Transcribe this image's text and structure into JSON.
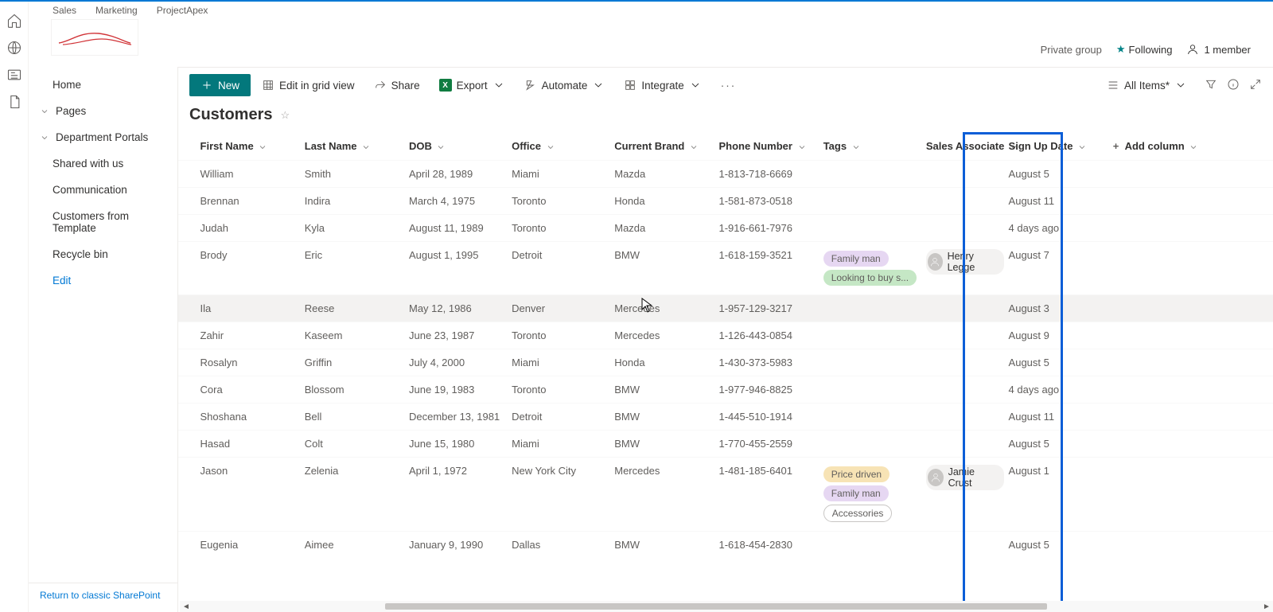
{
  "header": {
    "tabs": [
      "Sales",
      "Marketing",
      "ProjectApex"
    ],
    "private_group": "Private group",
    "following": "Following",
    "members": "1 member"
  },
  "nav": {
    "items": [
      {
        "label": "Home",
        "chev": false
      },
      {
        "label": "Pages",
        "chev": true
      },
      {
        "label": "Department Portals",
        "chev": true
      },
      {
        "label": "Shared with us",
        "chev": false
      },
      {
        "label": "Communication",
        "chev": false
      },
      {
        "label": "Customers from Template",
        "chev": false
      },
      {
        "label": "Recycle bin",
        "chev": false
      }
    ],
    "edit": "Edit",
    "footer": "Return to classic SharePoint"
  },
  "cmdbar": {
    "new_label": "New",
    "edit_grid": "Edit in grid view",
    "share": "Share",
    "export": "Export",
    "automate": "Automate",
    "integrate": "Integrate",
    "view": "All Items*"
  },
  "list": {
    "title": "Customers",
    "columns": [
      "First Name",
      "Last Name",
      "DOB",
      "Office",
      "Current Brand",
      "Phone Number",
      "Tags",
      "Sales Associate",
      "Sign Up Date"
    ],
    "add_column": "Add column",
    "rows": [
      {
        "fn": "William",
        "ln": "Smith",
        "dob": "April 28, 1989",
        "off": "Miami",
        "brand": "Mazda",
        "phone": "1-813-718-6669",
        "tags": [],
        "assoc": "",
        "sign": "August 5"
      },
      {
        "fn": "Brennan",
        "ln": "Indira",
        "dob": "March 4, 1975",
        "off": "Toronto",
        "brand": "Honda",
        "phone": "1-581-873-0518",
        "tags": [],
        "assoc": "",
        "sign": "August 11"
      },
      {
        "fn": "Judah",
        "ln": "Kyla",
        "dob": "August 11, 1989",
        "off": "Toronto",
        "brand": "Mazda",
        "phone": "1-916-661-7976",
        "tags": [],
        "assoc": "",
        "sign": "4 days ago"
      },
      {
        "fn": "Brody",
        "ln": "Eric",
        "dob": "August 1, 1995",
        "off": "Detroit",
        "brand": "BMW",
        "phone": "1-618-159-3521",
        "tags": [
          {
            "t": "Family man",
            "c": "#e6d7f2"
          },
          {
            "t": "Looking to buy s...",
            "c": "#c5e7c5"
          }
        ],
        "assoc": "Henry Legge",
        "sign": "August 7"
      },
      {
        "fn": "Ila",
        "ln": "Reese",
        "dob": "May 12, 1986",
        "off": "Denver",
        "brand": "Mercedes",
        "phone": "1-957-129-3217",
        "tags": [],
        "assoc": "",
        "sign": "August 3",
        "hover": true
      },
      {
        "fn": "Zahir",
        "ln": "Kaseem",
        "dob": "June 23, 1987",
        "off": "Toronto",
        "brand": "Mercedes",
        "phone": "1-126-443-0854",
        "tags": [],
        "assoc": "",
        "sign": "August 9"
      },
      {
        "fn": "Rosalyn",
        "ln": "Griffin",
        "dob": "July 4, 2000",
        "off": "Miami",
        "brand": "Honda",
        "phone": "1-430-373-5983",
        "tags": [],
        "assoc": "",
        "sign": "August 5"
      },
      {
        "fn": "Cora",
        "ln": "Blossom",
        "dob": "June 19, 1983",
        "off": "Toronto",
        "brand": "BMW",
        "phone": "1-977-946-8825",
        "tags": [],
        "assoc": "",
        "sign": "4 days ago"
      },
      {
        "fn": "Shoshana",
        "ln": "Bell",
        "dob": "December 13, 1981",
        "off": "Detroit",
        "brand": "BMW",
        "phone": "1-445-510-1914",
        "tags": [],
        "assoc": "",
        "sign": "August 11"
      },
      {
        "fn": "Hasad",
        "ln": "Colt",
        "dob": "June 15, 1980",
        "off": "Miami",
        "brand": "BMW",
        "phone": "1-770-455-2559",
        "tags": [],
        "assoc": "",
        "sign": "August 5"
      },
      {
        "fn": "Jason",
        "ln": "Zelenia",
        "dob": "April 1, 1972",
        "off": "New York City",
        "brand": "Mercedes",
        "phone": "1-481-185-6401",
        "tags": [
          {
            "t": "Price driven",
            "c": "#f7e3b5"
          },
          {
            "t": "Family man",
            "c": "#e6d7f2"
          },
          {
            "t": "Accessories",
            "c": "#ffffff",
            "b": "#c8c6c4"
          }
        ],
        "assoc": "Jamie Crust",
        "sign": "August 1"
      },
      {
        "fn": "Eugenia",
        "ln": "Aimee",
        "dob": "January 9, 1990",
        "off": "Dallas",
        "brand": "BMW",
        "phone": "1-618-454-2830",
        "tags": [],
        "assoc": "",
        "sign": "August 5"
      }
    ]
  }
}
